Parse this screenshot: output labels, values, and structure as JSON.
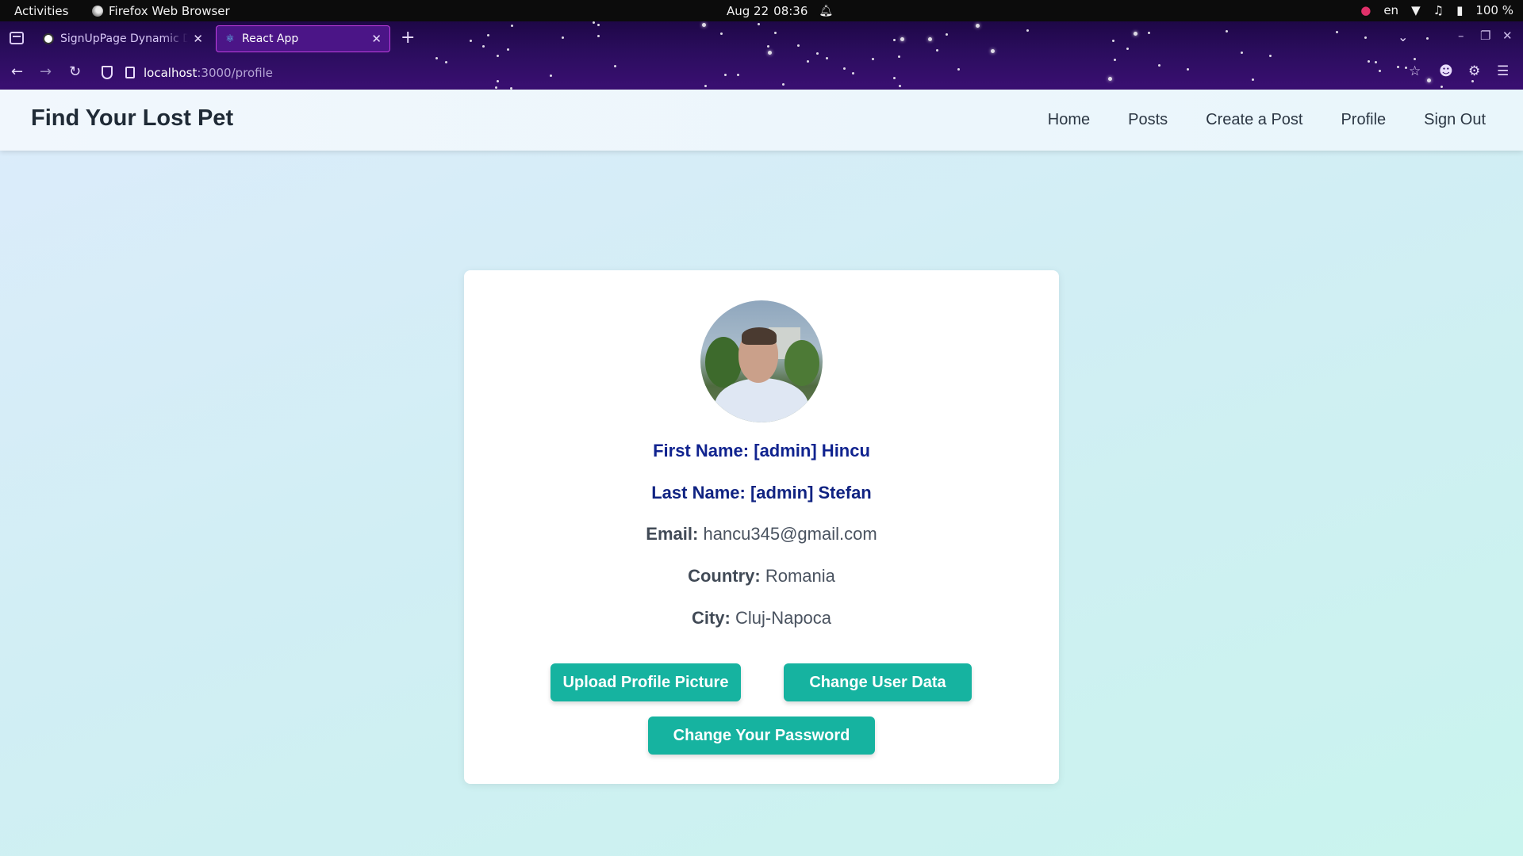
{
  "os_bar": {
    "activities": "Activities",
    "app_name": "Firefox Web Browser",
    "date": "Aug 22",
    "time": "08:36",
    "language": "en",
    "battery": "100 %"
  },
  "browser": {
    "tabs": [
      {
        "label": "SignUpPage Dynamic Dr",
        "active": false
      },
      {
        "label": "React App",
        "active": true
      }
    ],
    "url_host": "localhost",
    "url_path": ":3000/profile"
  },
  "app": {
    "brand": "Find Your Lost Pet",
    "nav": [
      "Home",
      "Posts",
      "Create a Post",
      "Profile",
      "Sign Out"
    ]
  },
  "profile": {
    "first_name_label": "First Name:",
    "first_name": "[admin] Hincu",
    "last_name_label": "Last Name:",
    "last_name": "[admin] Stefan",
    "email_label": "Email:",
    "email": "hancu345@gmail.com",
    "country_label": "Country:",
    "country": "Romania",
    "city_label": "City:",
    "city": "Cluj-Napoca"
  },
  "actions": {
    "upload": "Upload Profile Picture",
    "change_data": "Change User Data",
    "change_password": "Change Your Password"
  },
  "colors": {
    "accent": "#16b3a0",
    "name_text": "#10238f",
    "chrome": "#2b0d5e"
  }
}
